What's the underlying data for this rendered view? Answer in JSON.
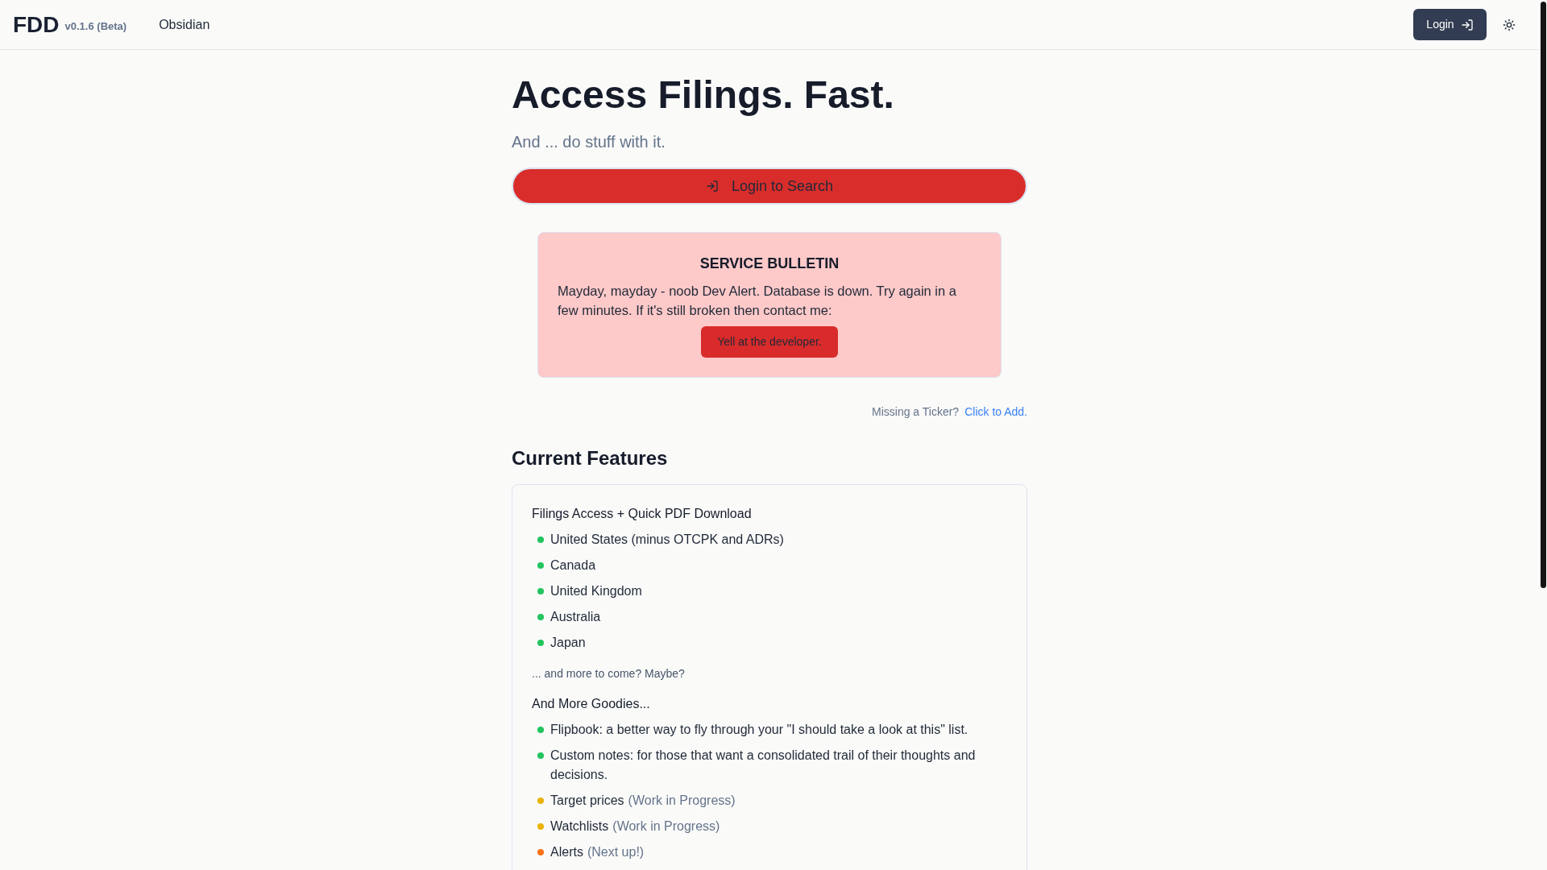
{
  "header": {
    "logo": "FDD",
    "version": "v0.1.6 (Beta)",
    "nav": [
      {
        "label": "Obsidian"
      }
    ],
    "login_button": "Login"
  },
  "hero": {
    "title": "Access Filings. Fast.",
    "subtitle": "And ... do stuff with it.",
    "search_button": "Login to Search"
  },
  "bulletin": {
    "title": "SERVICE BULLETIN",
    "message": "Mayday, mayday - noob Dev Alert. Database is down. Try again in a few minutes. If it's still broken then contact me:",
    "button": "Yell at the developer."
  },
  "ticker_prompt": {
    "text": "Missing a Ticker?",
    "link": "Click to Add."
  },
  "features": {
    "heading": "Current Features",
    "sections": [
      {
        "title": "Filings Access + Quick PDF Download",
        "items": [
          {
            "text": "United States (minus OTCPK and ADRs)",
            "color": "#22c55e"
          },
          {
            "text": "Canada",
            "color": "#22c55e"
          },
          {
            "text": "United Kingdom",
            "color": "#22c55e"
          },
          {
            "text": "Australia",
            "color": "#22c55e"
          },
          {
            "text": "Japan",
            "color": "#22c55e"
          }
        ],
        "footnote": "... and more to come? Maybe?"
      },
      {
        "title": "And More Goodies...",
        "items": [
          {
            "text": "Flipbook: a better way to fly through your \"I should take a look at this\" list.",
            "color": "#22c55e"
          },
          {
            "text": "Custom notes: for those that want a consolidated trail of their thoughts and decisions.",
            "color": "#22c55e"
          },
          {
            "text": "Target prices",
            "note": "(Work in Progress)",
            "color": "#eab308"
          },
          {
            "text": "Watchlists",
            "note": "(Work in Progress)",
            "color": "#eab308"
          },
          {
            "text": "Alerts",
            "note": "(Next up!)",
            "color": "#f97316"
          }
        ]
      }
    ]
  }
}
